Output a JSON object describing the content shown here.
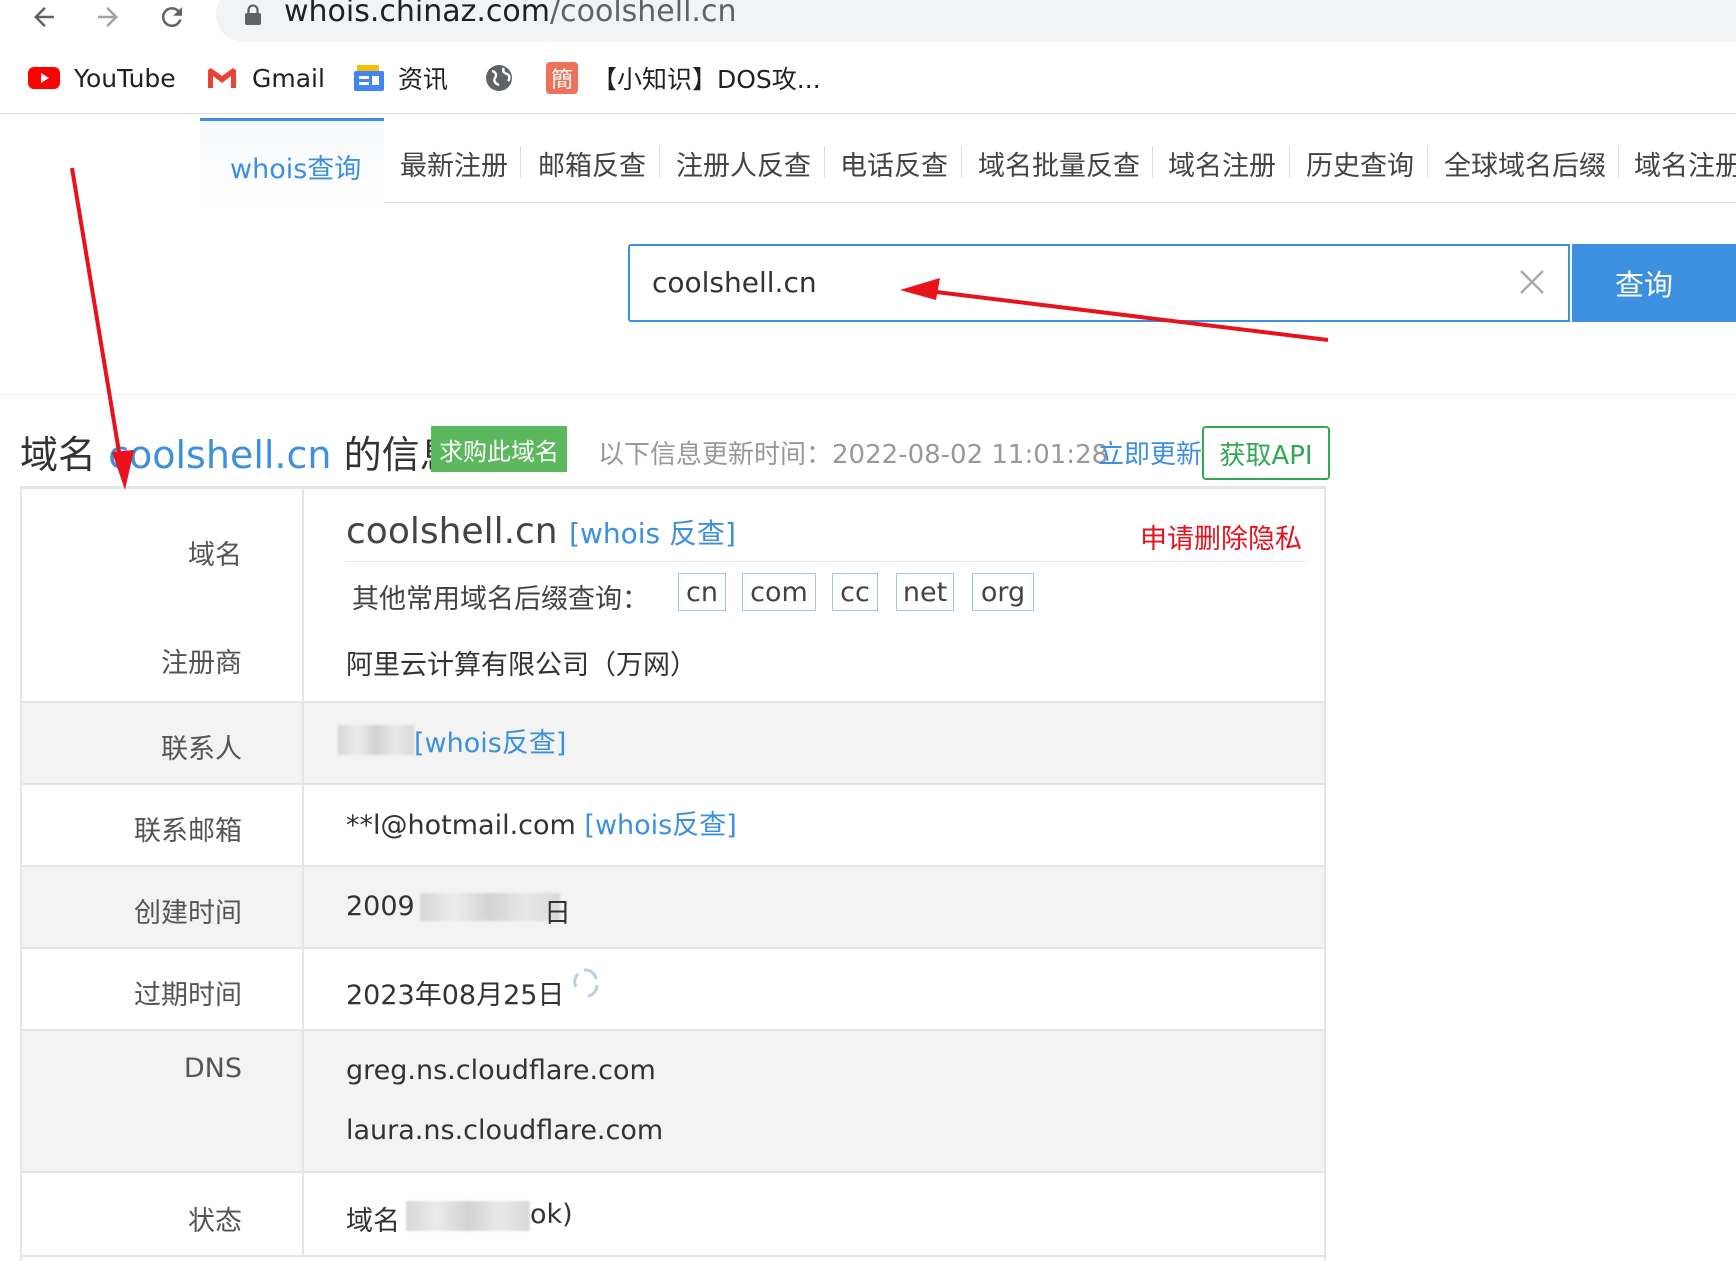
{
  "browser": {
    "url_host": "whois.chinaz.com",
    "url_path": "/coolshell.cn",
    "bookmarks": [
      {
        "icon": "youtube-icon",
        "label": "YouTube"
      },
      {
        "icon": "gmail-icon",
        "label": "Gmail"
      },
      {
        "icon": "google-news-icon",
        "label": "资讯"
      },
      {
        "icon": "globe-icon",
        "label": ""
      },
      {
        "icon": "jian-icon",
        "label": "【小知识】DOS攻..."
      }
    ]
  },
  "nav": {
    "active_tab": "whois查询",
    "tabs": [
      "最新注册",
      "邮箱反查",
      "注册人反查",
      "电话反查",
      "域名批量反查",
      "域名注册",
      "历史查询",
      "全球域名后缀",
      "域名注册"
    ]
  },
  "search": {
    "value": "coolshell.cn",
    "button": "查询"
  },
  "info": {
    "title_prefix": "域名",
    "title_domain": "coolshell.cn",
    "title_suffix": "的信息",
    "buy_badge": "求购此域名",
    "update_label": "以下信息更新时间：",
    "update_time": "2022-08-02 11:01:28",
    "update_link": "立即更新",
    "api_button": "获取API"
  },
  "rows": {
    "domain": {
      "label": "域名",
      "value": "coolshell.cn",
      "link": "[whois 反查]",
      "privacy": "申请删除隐私",
      "suffix_label": "其他常用域名后缀查询：",
      "suffixes": [
        "cn",
        "com",
        "cc",
        "net",
        "org"
      ]
    },
    "registrar": {
      "label": "注册商",
      "value": "阿里云计算有限公司（万网）"
    },
    "contact": {
      "label": "联系人",
      "link": "[whois反查]"
    },
    "email": {
      "label": "联系邮箱",
      "value": "**l@hotmail.com",
      "link": "[whois反查]"
    },
    "created": {
      "label": "创建时间",
      "value_start": "2009",
      "value_end": "日"
    },
    "expires": {
      "label": "过期时间",
      "value": "2023年08月25日"
    },
    "dns": {
      "label": "DNS",
      "servers": [
        "greg.ns.cloudflare.com",
        "laura.ns.cloudflare.com"
      ]
    },
    "status": {
      "label": "状态",
      "value_start": "域名",
      "value_end": "ok)"
    }
  },
  "colors": {
    "accent": "#3d8fe0",
    "buy_badge": "#5cb85c",
    "api_green": "#32a852",
    "privacy_red": "#e8121c",
    "annotation_arrow": "#e8121c"
  }
}
